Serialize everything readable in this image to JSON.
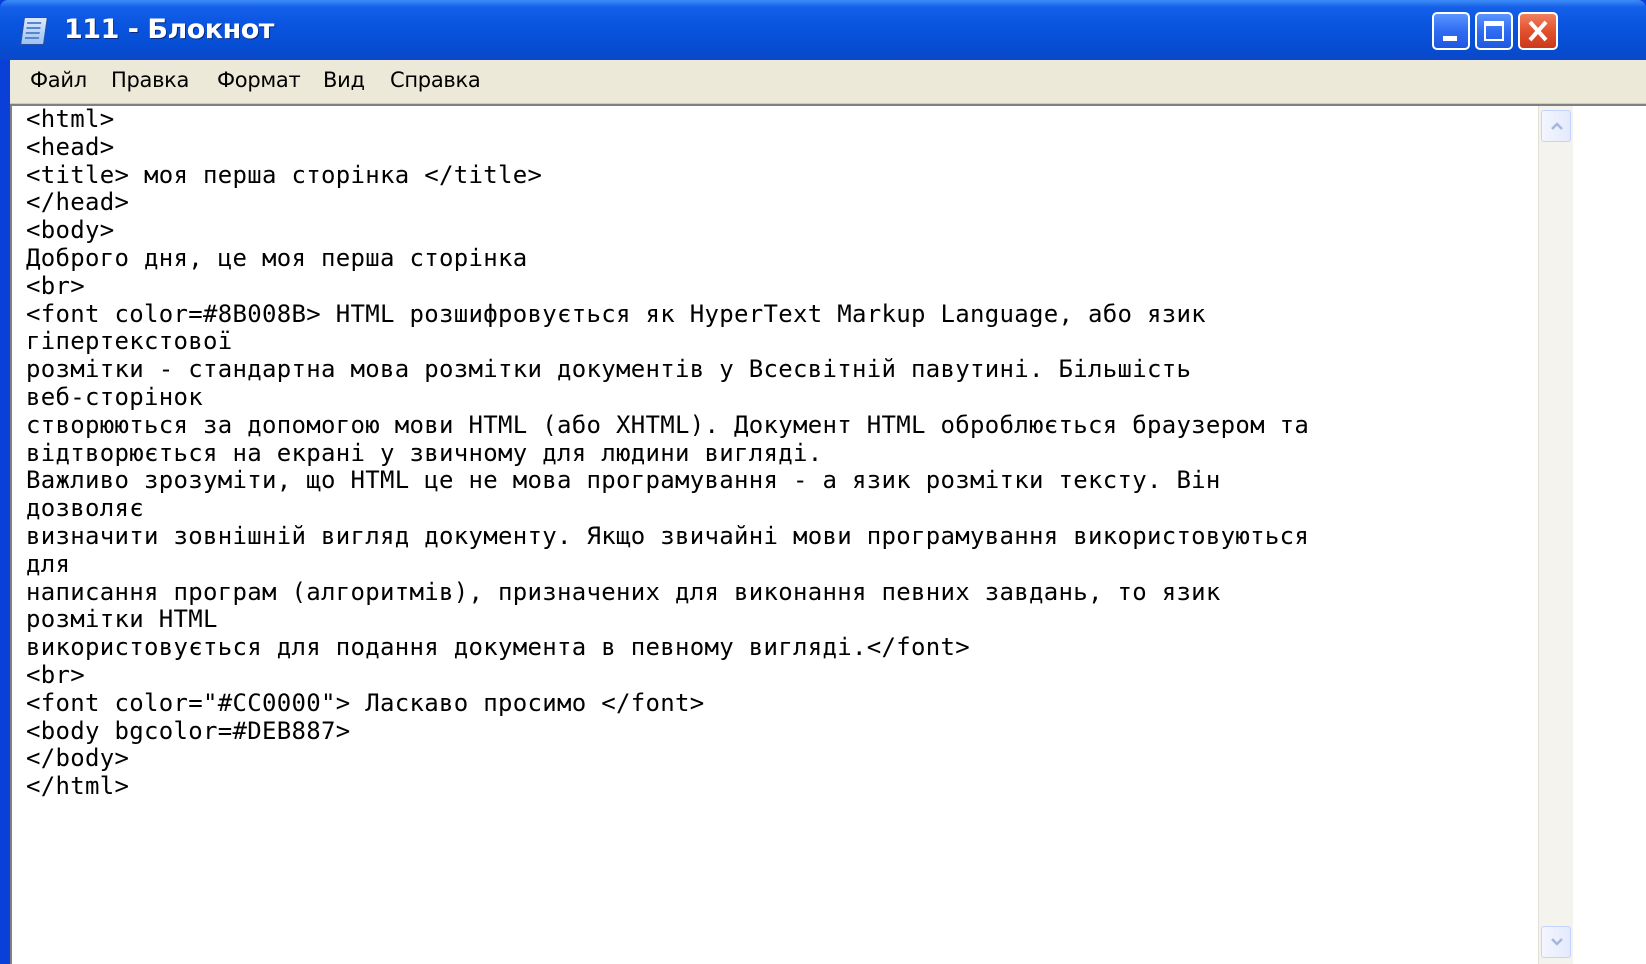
{
  "window": {
    "title": "111 - Блокнот"
  },
  "menu": {
    "file": "Файл",
    "edit": "Правка",
    "format": "Формат",
    "view": "Вид",
    "help": "Справка"
  },
  "editor": {
    "content": "<html>\n<head>\n<title> моя перша сторінка </title>\n</head>\n<body>\nДоброго дня, це моя перша сторінка\n<br>\n<font color=#8B008B> HTML розшифровується як HyperText Markup Language, або язик\nгіпертекстової\nрозмітки - стандартна мова розмітки документів у Всесвітній павутині. Більшість\nвеб-сторінок\nстворюються за допомогою мови HTML (або XHTML). Документ HTML оброблюється браузером та\nвідтворюється на екрані у звичному для людини вигляді.\nВажливо зрозуміти, що HTML це не мова програмування - а язик розмітки тексту. Він\nдозволяє\nвизначити зовнішній вигляд документу. Якщо звичайні мови програмування використовуються\nдля\nнаписання програм (алгоритмів), призначених для виконання певних завдань, то язик\nрозмітки HTML\nвикористовується для подання документа в певному вигляді.</font>\n<br>\n<font color=\"#CC0000\"> Ласкаво просимо </font>\n<body bgcolor=#DEB887>\n</body>\n</html>"
  },
  "colors": {
    "titlebar": "#0a55e0",
    "menubar": "#ece9d8",
    "close_button": "#e2512d",
    "editor_background": "#ffffff"
  },
  "icons": {
    "app": "notepad-icon",
    "minimize": "minimize-icon",
    "maximize": "maximize-icon",
    "close": "close-icon",
    "scroll_up": "chevron-up-icon",
    "scroll_down": "chevron-down-icon"
  }
}
